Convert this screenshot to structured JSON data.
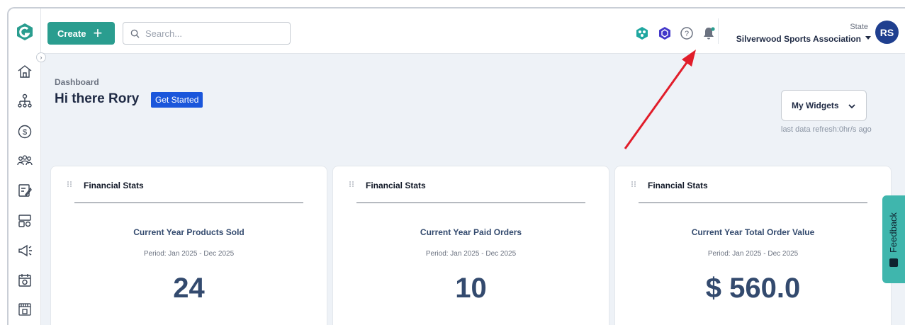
{
  "header": {
    "create_label": "Create",
    "search_placeholder": "Search...",
    "state_label": "State",
    "org_name": "Silverwood Sports Association",
    "avatar_initials": "RS"
  },
  "main": {
    "breadcrumb": "Dashboard",
    "greeting": "Hi there Rory",
    "get_started_label": "Get Started",
    "widgets_dropdown_value": "My Widgets",
    "last_refresh": "last data refresh:0hr/s ago"
  },
  "cards": [
    {
      "title": "Financial Stats",
      "label": "Current Year Products Sold",
      "period": "Period: Jan 2025 - Dec 2025",
      "value": "24"
    },
    {
      "title": "Financial Stats",
      "label": "Current Year Paid Orders",
      "period": "Period: Jan 2025 - Dec 2025",
      "value": "10"
    },
    {
      "title": "Financial Stats",
      "label": "Current Year Total Order Value",
      "period": "Period: Jan 2025 - Dec 2025",
      "value": "$ 560.0"
    }
  ],
  "feedback_label": "Feedback",
  "colors": {
    "accent": "#2a9d8f",
    "get_started": "#1a56db",
    "avatar": "#1f3f8f",
    "feedback": "#3fb6ad",
    "annotation_arrow": "#e11d2a"
  },
  "icons": {
    "sidebar": [
      "home-icon",
      "org-hierarchy-icon",
      "dollar-icon",
      "members-icon",
      "forms-icon",
      "registration-icon",
      "megaphone-icon",
      "calendar-icon",
      "venue-icon"
    ],
    "topbar": [
      "integration-hub-icon",
      "hexagon-app-icon",
      "help-icon",
      "notification-bell-icon"
    ]
  }
}
